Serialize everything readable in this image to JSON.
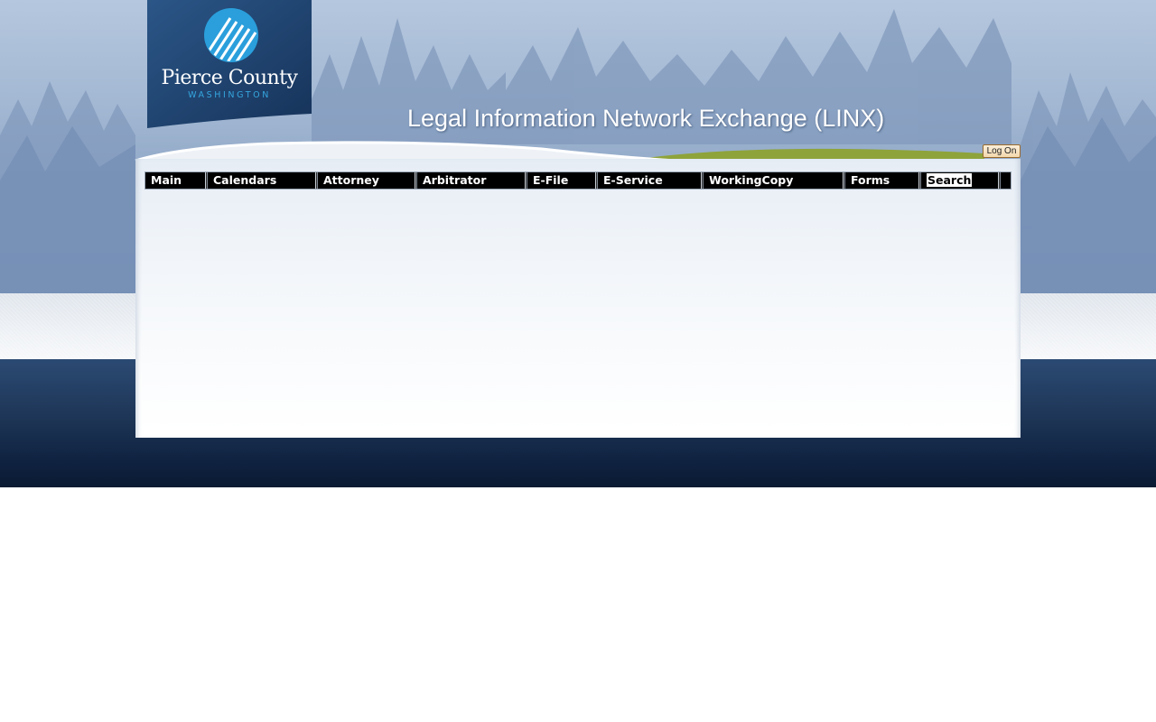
{
  "header": {
    "logo": {
      "name": "Pierce County",
      "subtitle": "WASHINGTON"
    },
    "title": "Legal Information Network Exchange (LINX)",
    "logon_label": "Log On"
  },
  "nav": {
    "items": [
      {
        "label": "Main",
        "key": "main"
      },
      {
        "label": "Calendars",
        "key": "calendars"
      },
      {
        "label": "Attorney",
        "key": "attorney"
      },
      {
        "label": "Arbitrator",
        "key": "arbitrator"
      },
      {
        "label": "E-File",
        "key": "e-file"
      },
      {
        "label": "E-Service",
        "key": "e-service"
      },
      {
        "label": "WorkingCopy",
        "key": "workingcopy"
      },
      {
        "label": "Forms",
        "key": "forms"
      },
      {
        "label": "Search",
        "key": "search"
      }
    ],
    "active": "Search"
  },
  "colors": {
    "sky": "#a3b8d3",
    "navy_band": "#1e3657",
    "logo_blue": "#1f3f6b",
    "accent_blue": "#35a6df",
    "hill_green": "#8ea33a",
    "nav_bg": "#000000"
  },
  "icons": {
    "logo_emblem": "mountain-stripes-icon"
  }
}
